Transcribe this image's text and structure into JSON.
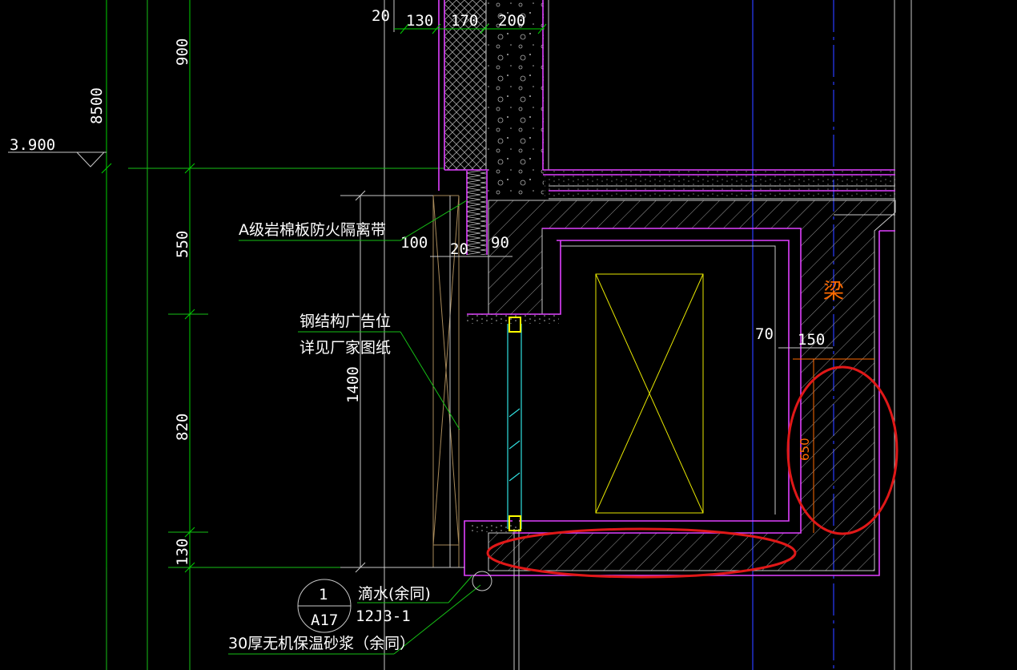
{
  "drawing": {
    "top_dims": [
      "20",
      "130",
      "170",
      "200"
    ],
    "vertical_dims": [
      "900",
      "550",
      "820",
      "130"
    ],
    "overall_dim": "8500",
    "inner_dim": "1400",
    "elevation": "3.900",
    "local_dims": {
      "d100": "100",
      "d20": "20",
      "d90": "90",
      "d70": "70",
      "d150": "150",
      "d650": "650"
    },
    "labels": {
      "firebreak": "A级岩棉板防火隔离带",
      "steel_ad_line1": "钢结构广告位",
      "steel_ad_line2": "详见厂家图纸",
      "drip_note": "滴水(余同)",
      "std_ref": "12J3-1",
      "mortar": "30厚无机保温砂浆（余同）",
      "beam": "梁"
    },
    "index_symbol": {
      "top": "1",
      "bottom": "A17"
    },
    "colors": {
      "background": "#000000",
      "dimension": "#00d000",
      "outline": "#e040ff",
      "window": "#30e0e0",
      "axis": "#2a3cff",
      "frame": "#e8e800",
      "highlight": "#e01818",
      "beam_text": "#ff6a00"
    }
  }
}
